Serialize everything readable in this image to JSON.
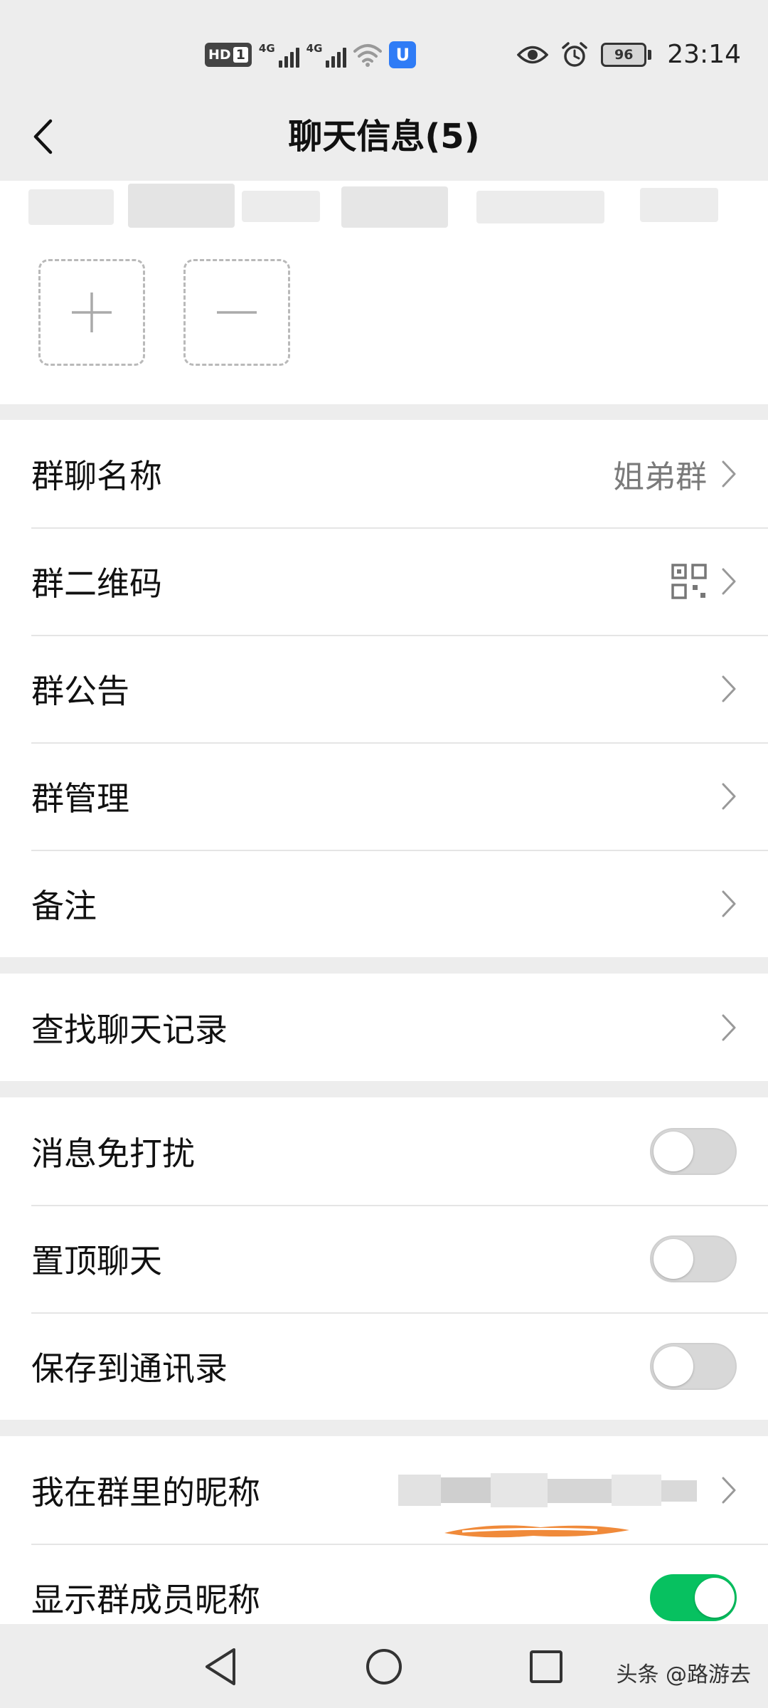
{
  "status_bar": {
    "hd_label": "HD",
    "sim_label": "1",
    "network_1": "4G",
    "network_2": "4G",
    "vpn_label": "U",
    "battery": "96",
    "time": "23:14"
  },
  "nav": {
    "title": "聊天信息(5)"
  },
  "group_info": {
    "name_label": "群聊名称",
    "name_value": "姐弟群",
    "qr_label": "群二维码",
    "notice_label": "群公告",
    "manage_label": "群管理",
    "remark_label": "备注"
  },
  "search": {
    "history_label": "查找聊天记录"
  },
  "settings": {
    "mute_label": "消息免打扰",
    "mute_on": false,
    "pin_label": "置顶聊天",
    "pin_on": false,
    "save_label": "保存到通讯录",
    "save_on": false
  },
  "nickname": {
    "my_nickname_label": "我在群里的昵称",
    "show_nicknames_label": "显示群成员昵称",
    "show_nicknames_on": true
  },
  "watermark": "头条 @路游去",
  "colors": {
    "accent_green": "#07c160",
    "background": "#ededed"
  }
}
